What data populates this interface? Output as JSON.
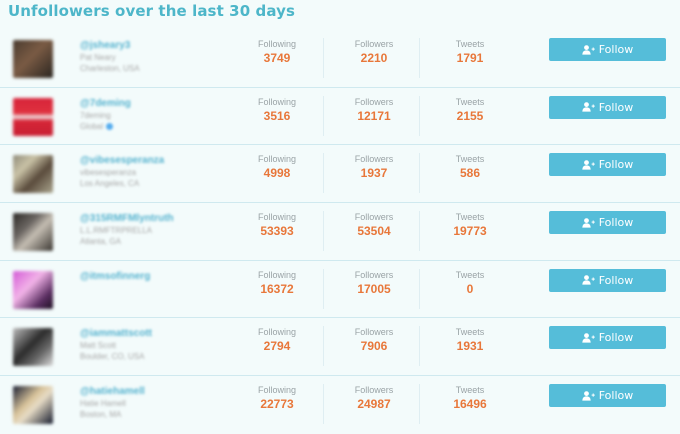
{
  "page": {
    "title": "Unfollowers over the last 30 days"
  },
  "labels": {
    "following": "Following",
    "followers": "Followers",
    "tweets": "Tweets",
    "follow_button": "Follow"
  },
  "colors": {
    "title": "#4db6c9",
    "stat_value": "#e8773a",
    "button": "#55bdd9"
  },
  "rows": [
    {
      "handle": "@jsheary3",
      "name": "Pat Neary",
      "location": "Charleston, USA",
      "following": "3749",
      "followers": "2210",
      "tweets": "1791"
    },
    {
      "handle": "@7deming",
      "name": "7deming",
      "location": "Global",
      "following": "3516",
      "followers": "12171",
      "tweets": "2155"
    },
    {
      "handle": "@vibesesperanza",
      "name": "vibesesperanza",
      "location": "Los Angeles, CA",
      "following": "4998",
      "followers": "1937",
      "tweets": "586"
    },
    {
      "handle": "@315RMFMlyntruth",
      "name": "L.L.RMFTRPRELLA",
      "location": "Atlanta, GA",
      "following": "53393",
      "followers": "53504",
      "tweets": "19773"
    },
    {
      "handle": "@itmsofinnerg",
      "name": "",
      "location": "",
      "following": "16372",
      "followers": "17005",
      "tweets": "0"
    },
    {
      "handle": "@iammattscott",
      "name": "Matt Scott",
      "location": "Boulder, CO, USA",
      "following": "2794",
      "followers": "7906",
      "tweets": "1931"
    },
    {
      "handle": "@hatiehamell",
      "name": "Hatie Hamell",
      "location": "Boston, MA",
      "following": "22773",
      "followers": "24987",
      "tweets": "16496"
    }
  ]
}
